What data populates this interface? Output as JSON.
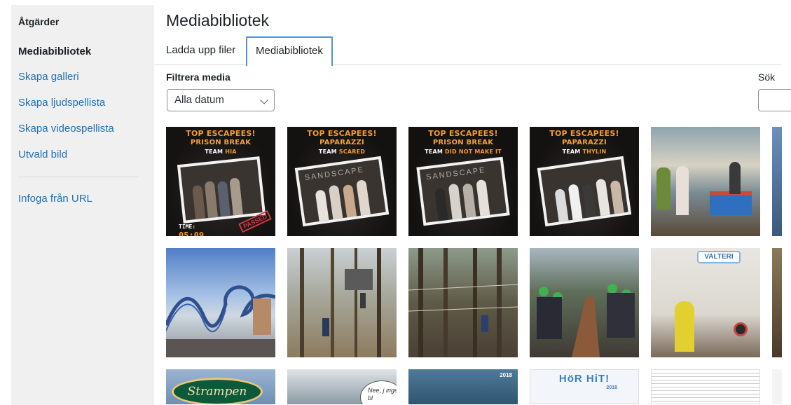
{
  "sidebar": {
    "heading": "Åtgärder",
    "items": [
      {
        "label": "Mediabibliotek",
        "active": true
      },
      {
        "label": "Skapa galleri"
      },
      {
        "label": "Skapa ljudspellista"
      },
      {
        "label": "Skapa videospellista"
      },
      {
        "label": "Utvald bild"
      },
      {
        "label": "Infoga från URL"
      }
    ]
  },
  "main": {
    "title": "Mediabibliotek",
    "tabs": [
      {
        "label": "Ladda upp filer"
      },
      {
        "label": "Mediabibliotek",
        "active": true
      }
    ],
    "filter_label": "Filtrera media",
    "date_select": "Alla datum",
    "search_label": "Sök"
  },
  "thumbs": {
    "t1": {
      "l1": "TOP ESCAPEES!",
      "l2": "PRISON BREAK",
      "team_prefix": "TEAM",
      "team": "HIA",
      "time_label": "TIME:",
      "time": "05:09",
      "stamp": "PASSED"
    },
    "t2": {
      "l1": "TOP ESCAPEES!",
      "l2": "PAPARAZZI",
      "team_prefix": "TEAM",
      "team": "SCARED",
      "logo": "SANDSCAPE"
    },
    "t3": {
      "l1": "TOP ESCAPEES!",
      "l2": "PRISON BREAK",
      "team_prefix": "TEAM",
      "team": "DID NOT MAKE IT",
      "logo": "SANDSCAPE"
    },
    "t4": {
      "l1": "TOP ESCAPEES!",
      "l2": "PAPARAZZI",
      "team_prefix": "TEAM",
      "team": "THYLIN"
    },
    "t10": {
      "banner": "VALTERI"
    },
    "t11": {
      "sign": "Strampen"
    },
    "t12": {
      "bubble": "Nee, j ingen bl"
    },
    "t13": {
      "year": "2018"
    },
    "t14": {
      "title": "HöR HiT!",
      "year": "2018"
    }
  },
  "colors": {
    "accent": "#2271b1",
    "tab_border": "#4f94d4",
    "poster_orange": "#f39a2b",
    "sidebar_bg": "#f0f0f1"
  }
}
